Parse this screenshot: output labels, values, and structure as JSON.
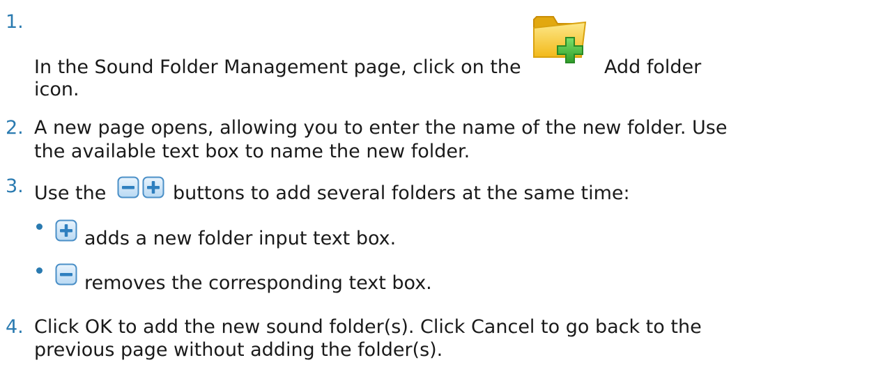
{
  "steps": [
    {
      "number": "1.",
      "text_before": "In the Sound Folder Management page, click on the",
      "text_after": "Add folder",
      "text_line2": "icon.",
      "icon": "add-folder-icon"
    },
    {
      "number": "2.",
      "line1": "A new page opens, allowing you to enter the name of the new folder. Use",
      "line2": "the available text box to name the new folder."
    },
    {
      "number": "3.",
      "text_before": "Use the",
      "text_after": "buttons to add several folders at the same time:",
      "icons": [
        "minus-button-icon",
        "plus-button-icon"
      ],
      "bullets": [
        {
          "icon": "plus-button-icon",
          "text": "adds a new folder input text box."
        },
        {
          "icon": "minus-button-icon",
          "text": "removes the corresponding text box."
        }
      ]
    },
    {
      "number": "4.",
      "line1": "Click OK to add the new sound folder(s). Click Cancel to go back to the",
      "line2": "previous page without adding the folder(s)."
    }
  ],
  "colors": {
    "number": "#2a7ab0",
    "text": "#1a1a1a",
    "icon_border": "#4a8fc7",
    "icon_fill": "#cfe6f9",
    "folder": "#f5c518",
    "plus_green": "#3cb43c"
  }
}
